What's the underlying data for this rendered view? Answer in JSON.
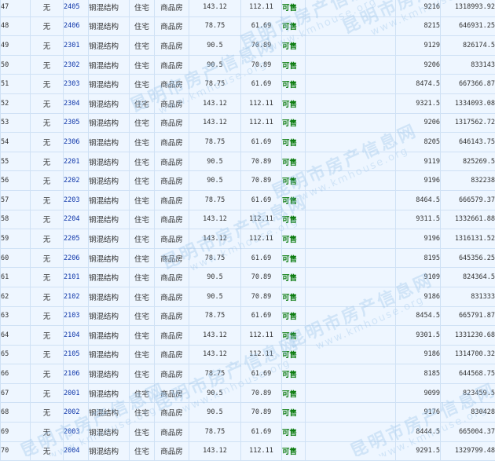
{
  "watermark": {
    "text": "昆明市房产信息网",
    "url": "www.kmhouse.org"
  },
  "colors": {
    "room_link": "#0b33a8",
    "status_available": "#0e7d12",
    "cell_bg": "#eef6ff",
    "border": "#cfe1f5"
  },
  "rows": [
    {
      "no": "47",
      "mortgage": "无",
      "room": "2405",
      "structure": "钢混结构",
      "use": "住宅",
      "type": "商品房",
      "area_build": "143.12",
      "area_inner": "112.11",
      "status": "可售",
      "price": "9216",
      "total": "1318993.92"
    },
    {
      "no": "48",
      "mortgage": "无",
      "room": "2406",
      "structure": "钢混结构",
      "use": "住宅",
      "type": "商品房",
      "area_build": "78.75",
      "area_inner": "61.69",
      "status": "可售",
      "price": "8215",
      "total": "646931.25"
    },
    {
      "no": "49",
      "mortgage": "无",
      "room": "2301",
      "structure": "钢混结构",
      "use": "住宅",
      "type": "商品房",
      "area_build": "90.5",
      "area_inner": "70.89",
      "status": "可售",
      "price": "9129",
      "total": "826174.5"
    },
    {
      "no": "50",
      "mortgage": "无",
      "room": "2302",
      "structure": "钢混结构",
      "use": "住宅",
      "type": "商品房",
      "area_build": "90.5",
      "area_inner": "70.89",
      "status": "可售",
      "price": "9206",
      "total": "833143"
    },
    {
      "no": "51",
      "mortgage": "无",
      "room": "2303",
      "structure": "钢混结构",
      "use": "住宅",
      "type": "商品房",
      "area_build": "78.75",
      "area_inner": "61.69",
      "status": "可售",
      "price": "8474.5",
      "total": "667366.87"
    },
    {
      "no": "52",
      "mortgage": "无",
      "room": "2304",
      "structure": "钢混结构",
      "use": "住宅",
      "type": "商品房",
      "area_build": "143.12",
      "area_inner": "112.11",
      "status": "可售",
      "price": "9321.5",
      "total": "1334093.08"
    },
    {
      "no": "53",
      "mortgage": "无",
      "room": "2305",
      "structure": "钢混结构",
      "use": "住宅",
      "type": "商品房",
      "area_build": "143.12",
      "area_inner": "112.11",
      "status": "可售",
      "price": "9206",
      "total": "1317562.72"
    },
    {
      "no": "54",
      "mortgage": "无",
      "room": "2306",
      "structure": "钢混结构",
      "use": "住宅",
      "type": "商品房",
      "area_build": "78.75",
      "area_inner": "61.69",
      "status": "可售",
      "price": "8205",
      "total": "646143.75"
    },
    {
      "no": "55",
      "mortgage": "无",
      "room": "2201",
      "structure": "钢混结构",
      "use": "住宅",
      "type": "商品房",
      "area_build": "90.5",
      "area_inner": "70.89",
      "status": "可售",
      "price": "9119",
      "total": "825269.5"
    },
    {
      "no": "56",
      "mortgage": "无",
      "room": "2202",
      "structure": "钢混结构",
      "use": "住宅",
      "type": "商品房",
      "area_build": "90.5",
      "area_inner": "70.89",
      "status": "可售",
      "price": "9196",
      "total": "832238"
    },
    {
      "no": "57",
      "mortgage": "无",
      "room": "2203",
      "structure": "钢混结构",
      "use": "住宅",
      "type": "商品房",
      "area_build": "78.75",
      "area_inner": "61.69",
      "status": "可售",
      "price": "8464.5",
      "total": "666579.37"
    },
    {
      "no": "58",
      "mortgage": "无",
      "room": "2204",
      "structure": "钢混结构",
      "use": "住宅",
      "type": "商品房",
      "area_build": "143.12",
      "area_inner": "112.11",
      "status": "可售",
      "price": "9311.5",
      "total": "1332661.88"
    },
    {
      "no": "59",
      "mortgage": "无",
      "room": "2205",
      "structure": "钢混结构",
      "use": "住宅",
      "type": "商品房",
      "area_build": "143.12",
      "area_inner": "112.11",
      "status": "可售",
      "price": "9196",
      "total": "1316131.52"
    },
    {
      "no": "60",
      "mortgage": "无",
      "room": "2206",
      "structure": "钢混结构",
      "use": "住宅",
      "type": "商品房",
      "area_build": "78.75",
      "area_inner": "61.69",
      "status": "可售",
      "price": "8195",
      "total": "645356.25"
    },
    {
      "no": "61",
      "mortgage": "无",
      "room": "2101",
      "structure": "钢混结构",
      "use": "住宅",
      "type": "商品房",
      "area_build": "90.5",
      "area_inner": "70.89",
      "status": "可售",
      "price": "9109",
      "total": "824364.5"
    },
    {
      "no": "62",
      "mortgage": "无",
      "room": "2102",
      "structure": "钢混结构",
      "use": "住宅",
      "type": "商品房",
      "area_build": "90.5",
      "area_inner": "70.89",
      "status": "可售",
      "price": "9186",
      "total": "831333"
    },
    {
      "no": "63",
      "mortgage": "无",
      "room": "2103",
      "structure": "钢混结构",
      "use": "住宅",
      "type": "商品房",
      "area_build": "78.75",
      "area_inner": "61.69",
      "status": "可售",
      "price": "8454.5",
      "total": "665791.87"
    },
    {
      "no": "64",
      "mortgage": "无",
      "room": "2104",
      "structure": "钢混结构",
      "use": "住宅",
      "type": "商品房",
      "area_build": "143.12",
      "area_inner": "112.11",
      "status": "可售",
      "price": "9301.5",
      "total": "1331230.68"
    },
    {
      "no": "65",
      "mortgage": "无",
      "room": "2105",
      "structure": "钢混结构",
      "use": "住宅",
      "type": "商品房",
      "area_build": "143.12",
      "area_inner": "112.11",
      "status": "可售",
      "price": "9186",
      "total": "1314700.32"
    },
    {
      "no": "66",
      "mortgage": "无",
      "room": "2106",
      "structure": "钢混结构",
      "use": "住宅",
      "type": "商品房",
      "area_build": "78.75",
      "area_inner": "61.69",
      "status": "可售",
      "price": "8185",
      "total": "644568.75"
    },
    {
      "no": "67",
      "mortgage": "无",
      "room": "2001",
      "structure": "钢混结构",
      "use": "住宅",
      "type": "商品房",
      "area_build": "90.5",
      "area_inner": "70.89",
      "status": "可售",
      "price": "9099",
      "total": "823459.5"
    },
    {
      "no": "68",
      "mortgage": "无",
      "room": "2002",
      "structure": "钢混结构",
      "use": "住宅",
      "type": "商品房",
      "area_build": "90.5",
      "area_inner": "70.89",
      "status": "可售",
      "price": "9176",
      "total": "830428"
    },
    {
      "no": "69",
      "mortgage": "无",
      "room": "2003",
      "structure": "钢混结构",
      "use": "住宅",
      "type": "商品房",
      "area_build": "78.75",
      "area_inner": "61.69",
      "status": "可售",
      "price": "8444.5",
      "total": "665004.37"
    },
    {
      "no": "70",
      "mortgage": "无",
      "room": "2004",
      "structure": "钢混结构",
      "use": "住宅",
      "type": "商品房",
      "area_build": "143.12",
      "area_inner": "112.11",
      "status": "可售",
      "price": "9291.5",
      "total": "1329799.48"
    }
  ]
}
